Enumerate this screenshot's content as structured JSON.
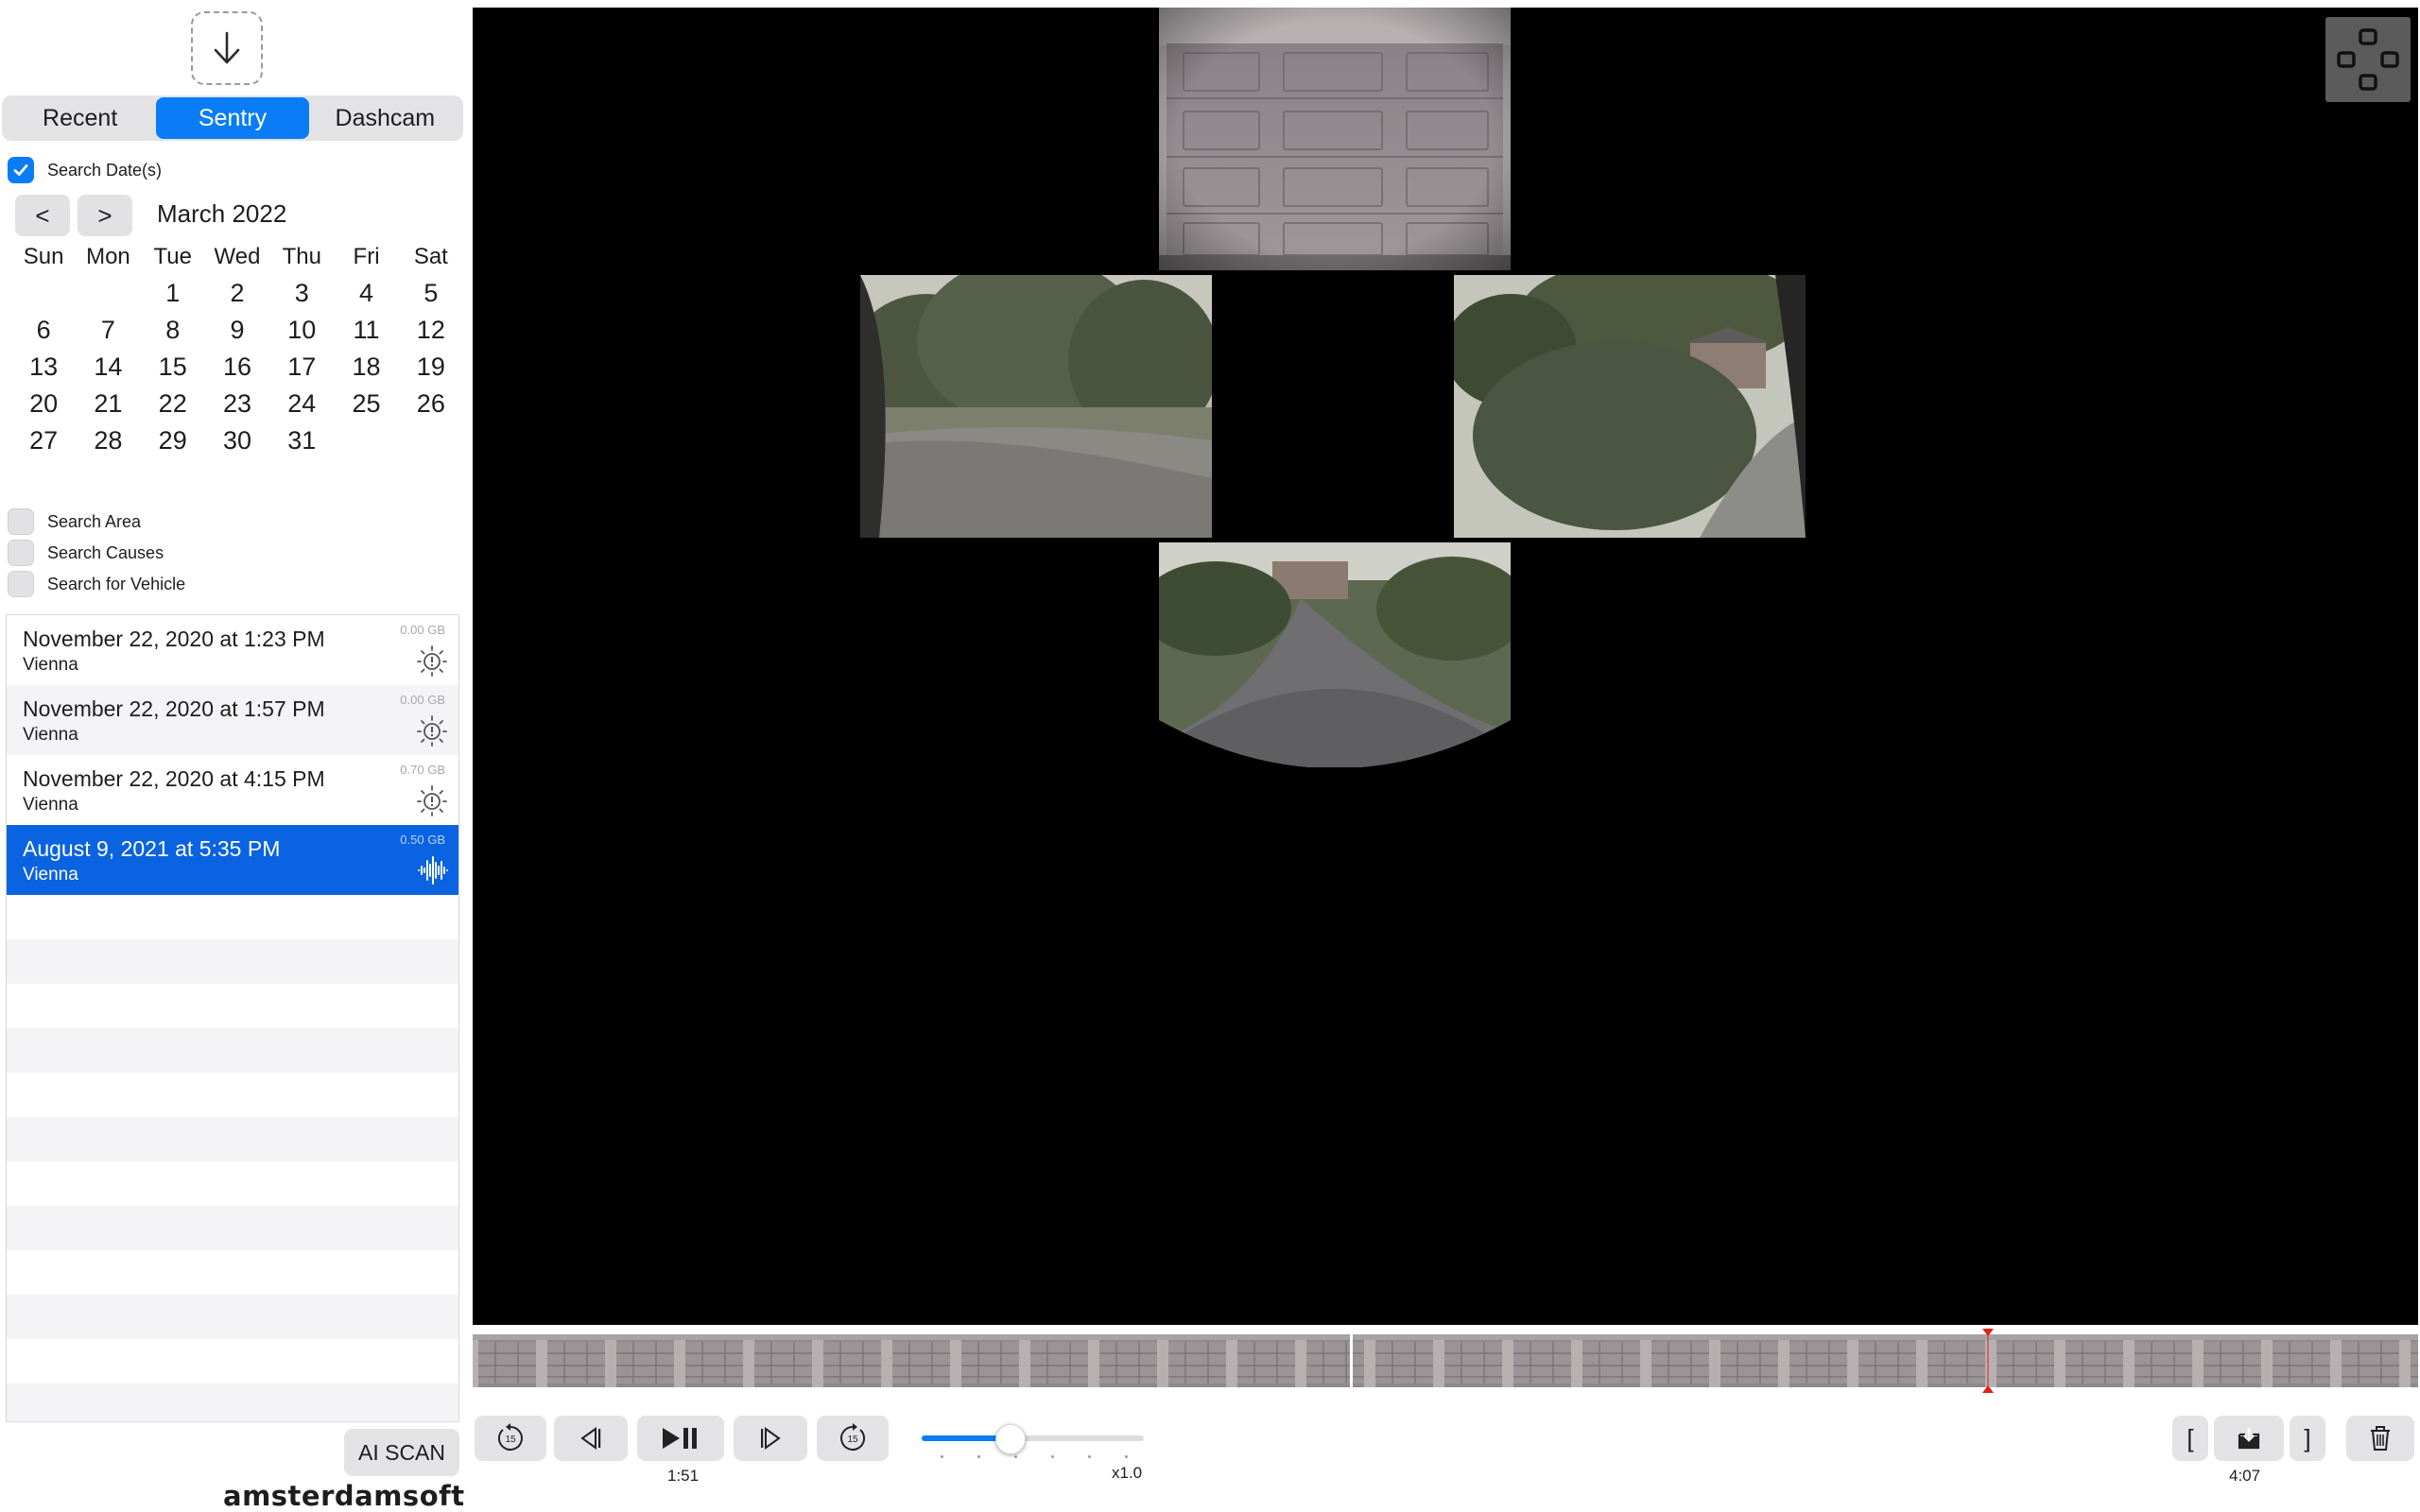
{
  "tabs": [
    {
      "label": "Recent",
      "active": false
    },
    {
      "label": "Sentry",
      "active": true
    },
    {
      "label": "Dashcam",
      "active": false
    }
  ],
  "filters": {
    "search_dates": {
      "label": "Search Date(s)",
      "checked": true
    },
    "search_area": {
      "label": "Search Area",
      "checked": false
    },
    "search_causes": {
      "label": "Search Causes",
      "checked": false
    },
    "search_vehicle": {
      "label": "Search for Vehicle",
      "checked": false
    }
  },
  "calendar": {
    "prev": "<",
    "next": ">",
    "month_label": "March 2022",
    "weekdays": [
      "Sun",
      "Mon",
      "Tue",
      "Wed",
      "Thu",
      "Fri",
      "Sat"
    ],
    "weeks": [
      [
        "",
        "",
        "1",
        "2",
        "3",
        "4",
        "5"
      ],
      [
        "6",
        "7",
        "8",
        "9",
        "10",
        "11",
        "12"
      ],
      [
        "13",
        "14",
        "15",
        "16",
        "17",
        "18",
        "19"
      ],
      [
        "20",
        "21",
        "22",
        "23",
        "24",
        "25",
        "26"
      ],
      [
        "27",
        "28",
        "29",
        "30",
        "31",
        "",
        ""
      ]
    ]
  },
  "events": [
    {
      "date": "November 22, 2020 at 1:23 PM",
      "location": "Vienna",
      "size": "0.00 GB",
      "icon": "sentry-alert-icon",
      "selected": false
    },
    {
      "date": "November 22, 2020 at 1:57 PM",
      "location": "Vienna",
      "size": "0.00 GB",
      "icon": "sentry-alert-icon",
      "selected": false
    },
    {
      "date": "November 22, 2020 at 4:15 PM",
      "location": "Vienna",
      "size": "0.70 GB",
      "icon": "sentry-alert-icon",
      "selected": false
    },
    {
      "date": "August 9, 2021 at 5:35 PM",
      "location": "Vienna",
      "size": "0.50 GB",
      "icon": "audio-waveform-icon",
      "selected": true
    }
  ],
  "ai_scan_label": "AI SCAN",
  "brand": "amsterdamsoft",
  "playback": {
    "current_time": "1:51",
    "speed_label": "x1.0",
    "speed_fraction": 0.4,
    "duration": "4:07",
    "marker_fraction": 0.779,
    "clip_split_fraction": 0.451
  },
  "clip_controls": {
    "in_mark": "[",
    "out_mark": "]"
  },
  "colors": {
    "accent": "#0a7cf5",
    "selected_row": "#0a63e0",
    "playhead": "#e0201a"
  }
}
